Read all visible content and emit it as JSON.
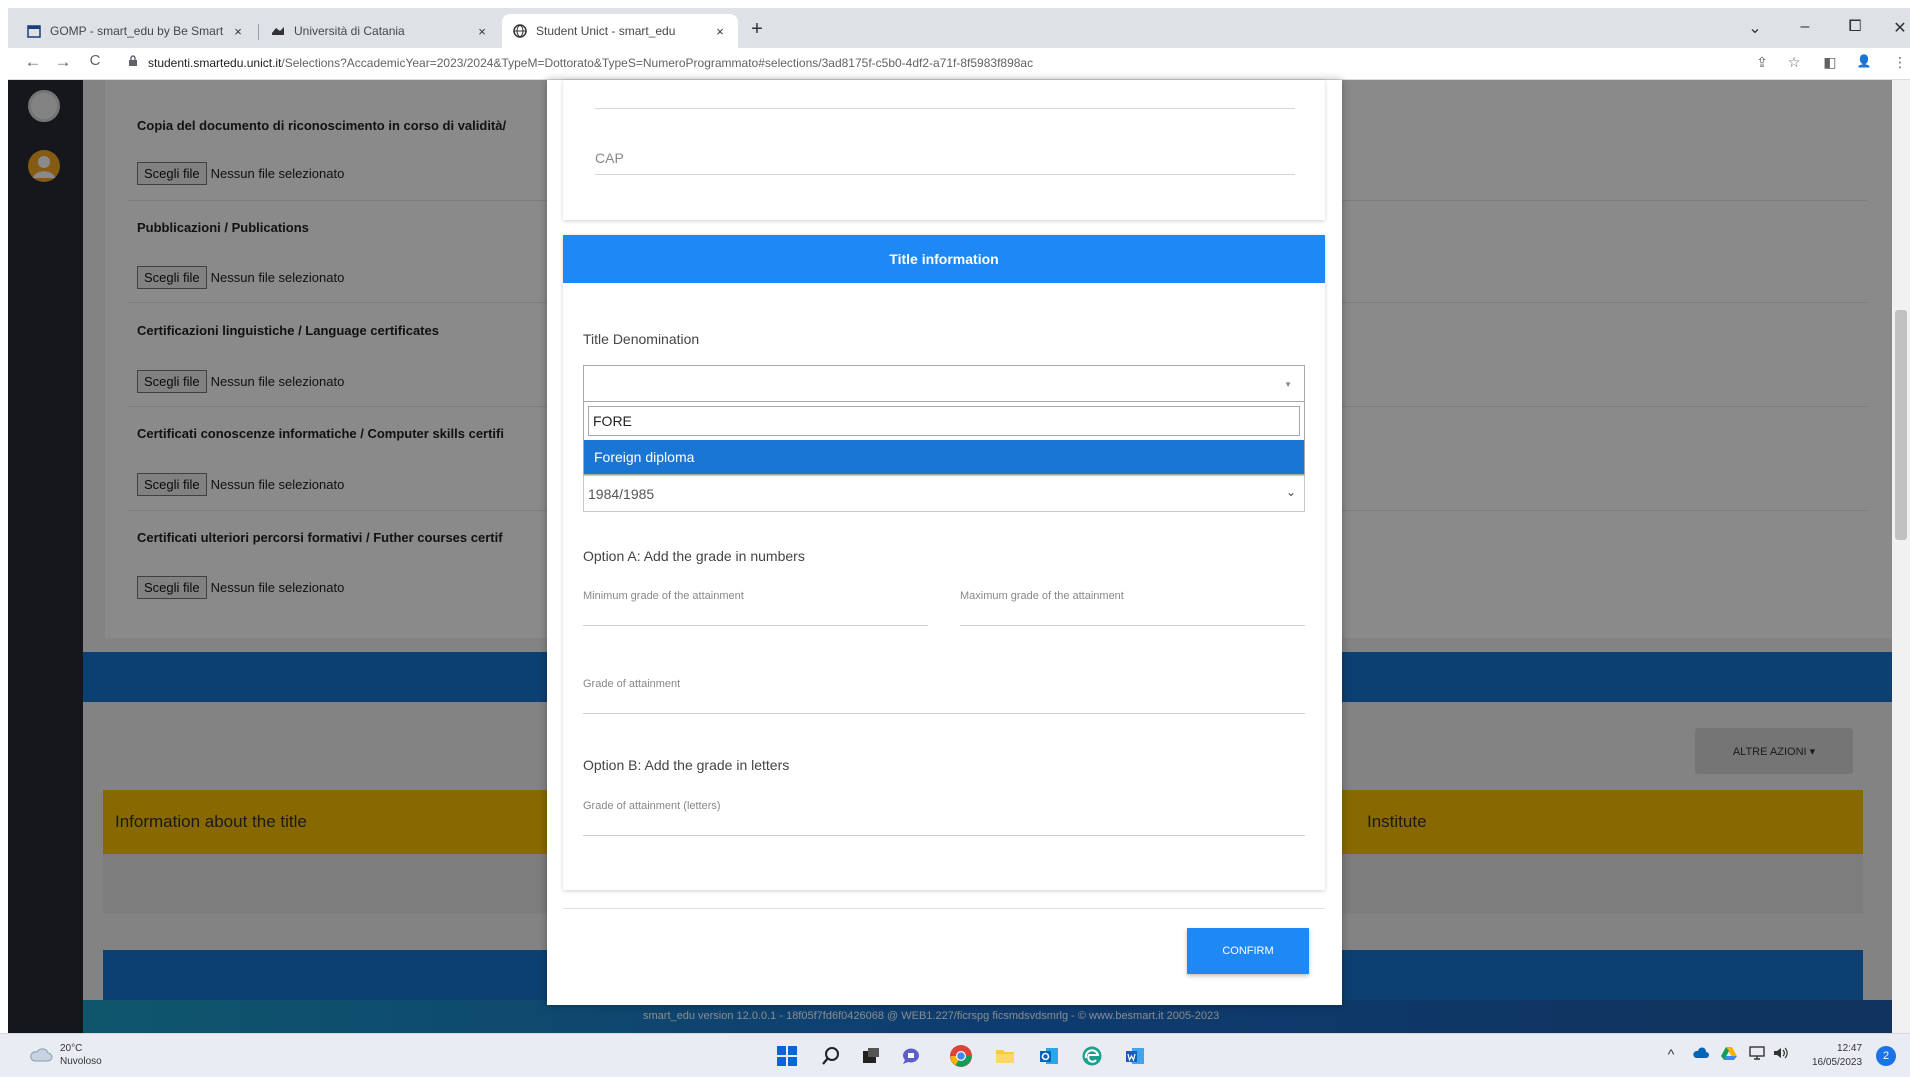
{
  "browser": {
    "tabs": [
      {
        "title": "GOMP - smart_edu by Be Smart",
        "close": "×"
      },
      {
        "title": "Università di Catania",
        "close": "×"
      },
      {
        "title": "Student Unict - smart_edu",
        "close": "×"
      }
    ],
    "new_tab": "+",
    "url_host": "studenti.smartedu.unict.it",
    "url_path": "/Selections?AccademicYear=2023/2024&TypeM=Dottorato&TypeS=NumeroProgrammato#selections/3ad8175f-c5b0-4df2-a71f-8f5983f898ac",
    "nav": {
      "back": "←",
      "forward": "→",
      "reload": "C"
    },
    "window_controls": {
      "down": "⌄",
      "minimize": "–",
      "restore": "⧠",
      "close": "✕"
    },
    "toolbar": {
      "share": "⇪",
      "star": "☆",
      "split": "◧",
      "profile": "👤",
      "menu": "⋮"
    }
  },
  "page": {
    "documents": [
      {
        "title": "Copia del documento di riconoscimento in corso di validità/"
      },
      {
        "title": "Pubblicazioni / Publications"
      },
      {
        "title": "Certificazioni linguistiche / Language certificates"
      },
      {
        "title": "Certificati conoscenze informatiche / Computer skills certifi"
      },
      {
        "title": "Certificati ulteriori percorsi formativi / Futher courses certif"
      }
    ],
    "file_button": "Scegli file",
    "file_none": "Nessun file selezionato",
    "altre_azioni": "ALTRE AZIONI ▾",
    "title_table": {
      "col1": "Information about the title",
      "col2": "Institute"
    },
    "footer": "smart_edu version 12.0.0.1 - 18f05f7fd6f0426068 @ WEB1.227/ficrspg ficsmdsvdsmrlg - © www.besmart.it 2005-2023"
  },
  "modal": {
    "cap_label": "CAP",
    "section_title": "Title information",
    "title_denomination_label": "Title Denomination",
    "search_value": "FORE",
    "highlighted_option": "Foreign diploma",
    "year_value": "1984/1985",
    "option_a_label": "Option A: Add the grade in numbers",
    "min_grade_label": "Minimum grade of the attainment",
    "max_grade_label": "Maximum grade of the attainment",
    "grade_label": "Grade of attainment",
    "option_b_label": "Option B: Add the grade in letters",
    "grade_letters_label": "Grade of attainment (letters)",
    "confirm_label": "CONFIRM"
  },
  "taskbar": {
    "weather_temp": "20°C",
    "weather_desc": "Nuvoloso",
    "time": "12:47",
    "date": "16/05/2023",
    "notification_count": "2"
  },
  "colors": {
    "primary": "#1e88f5",
    "highlight": "#1976d2",
    "accent_yellow": "#f9c200",
    "sidebar": "#272c33"
  }
}
